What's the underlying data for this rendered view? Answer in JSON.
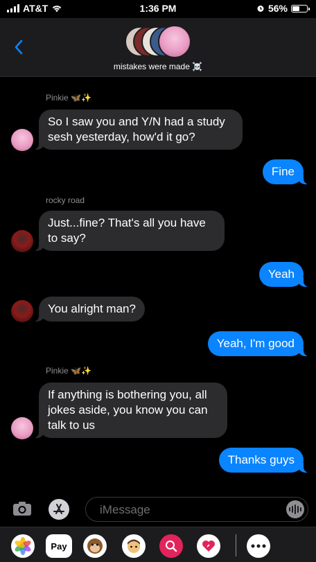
{
  "status_bar": {
    "carrier": "AT&T",
    "time": "1:36 PM",
    "battery": "56%",
    "battery_level": 0.56
  },
  "header": {
    "group_name": "mistakes were made ☠️"
  },
  "messages": [
    {
      "sender": "Pinkie 🦋✨",
      "text": "So I saw you and Y/N had a study sesh yesterday, how'd it go?"
    },
    {
      "text": "Fine"
    },
    {
      "sender": "rocky road",
      "text": "Just...fine? That's all you have to say?"
    },
    {
      "text": "Yeah"
    },
    {
      "text": "You alright man?"
    },
    {
      "text": "Yeah, I'm good"
    },
    {
      "sender": "Pinkie 🦋✨",
      "text": "If anything is bothering you, all jokes aside, you know you can talk to us"
    },
    {
      "text": "Thanks guys"
    }
  ],
  "composer": {
    "placeholder": "iMessage"
  },
  "app_tray": {
    "apple_pay_label": "Pay"
  },
  "icons": {
    "back": "chevron-left-icon",
    "camera": "camera-icon",
    "apps": "app-store-icon",
    "audio": "waveform-icon"
  },
  "colors": {
    "outgoing_bubble": "#0a84ff",
    "incoming_bubble": "#2c2c2e",
    "background": "#000000"
  }
}
